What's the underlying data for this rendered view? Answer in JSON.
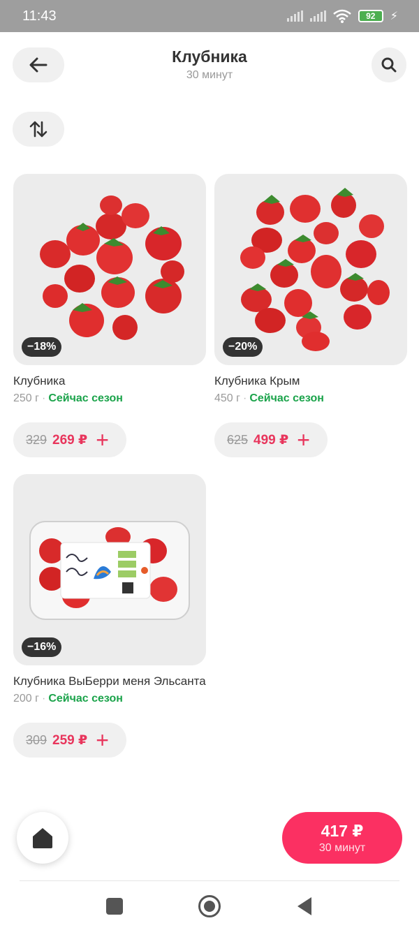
{
  "status": {
    "time": "11:43",
    "battery": "92"
  },
  "header": {
    "title": "Клубника",
    "subtitle": "30 минут"
  },
  "products": [
    {
      "name": "Клубника",
      "weight": "250 г",
      "season": "Сейчас сезон",
      "discount": "−18%",
      "old_price": "329",
      "new_price": "269 ₽"
    },
    {
      "name": "Клубника Крым",
      "weight": "450 г",
      "season": "Сейчас сезон",
      "discount": "−20%",
      "old_price": "625",
      "new_price": "499 ₽"
    },
    {
      "name": "Клубника ВыБерри меня Эльсанта",
      "weight": "200 г",
      "season": "Сейчас сезон",
      "discount": "−16%",
      "old_price": "309",
      "new_price": "259 ₽"
    }
  ],
  "cart": {
    "price": "417 ₽",
    "time": "30 минут"
  },
  "colors": {
    "accent": "#fb3062",
    "price": "#e8355c",
    "season": "#1aa34a"
  },
  "icons": {
    "back": "arrow-left-icon",
    "search": "search-icon",
    "sort": "sort-icon",
    "add": "plus-icon",
    "home": "home-icon"
  }
}
